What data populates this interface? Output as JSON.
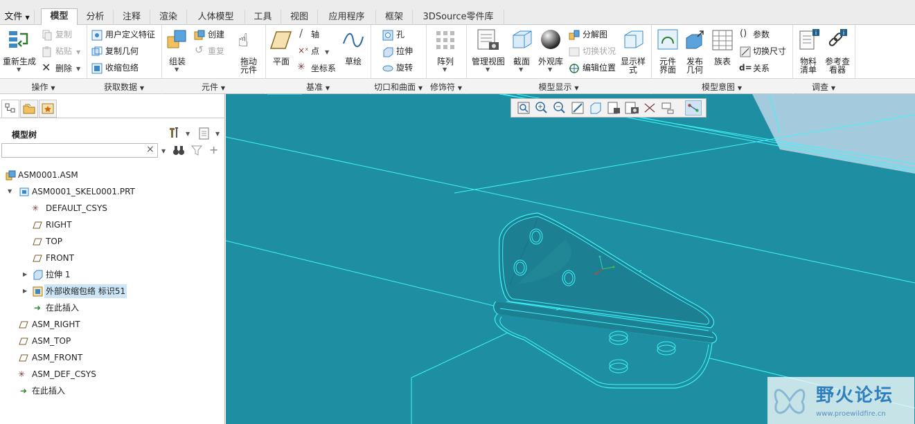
{
  "menu": {
    "file": "文件",
    "tabs": [
      {
        "label": "模型",
        "active": true
      },
      {
        "label": "分析"
      },
      {
        "label": "注释"
      },
      {
        "label": "渲染"
      },
      {
        "label": "人体模型"
      },
      {
        "label": "工具"
      },
      {
        "label": "视图"
      },
      {
        "label": "应用程序"
      },
      {
        "label": "框架"
      },
      {
        "label": "3DSource零件库"
      }
    ]
  },
  "ribbon": {
    "operations": {
      "regenerate": "重新生成",
      "copy": "复制",
      "paste": "粘贴",
      "delete": "删除",
      "group": "操作"
    },
    "get_data": {
      "udf": "用户定义特征",
      "copy_geom": "复制几何",
      "shrinkwrap": "收缩包络",
      "group": "获取数据"
    },
    "component": {
      "assemble": "组装",
      "create": "创建",
      "repeat": "重复",
      "drag_l1": "拖动",
      "drag_l2": "元件",
      "group": "元件"
    },
    "datum": {
      "plane": "平面",
      "axis": "轴",
      "point": "点",
      "csys": "坐标系",
      "sketch": "草绘",
      "group": "基准"
    },
    "cut_surface": {
      "hole": "孔",
      "extrude": "拉伸",
      "revolve": "旋转",
      "group": "切口和曲面"
    },
    "modifiers": {
      "pattern": "阵列",
      "group": "修饰符"
    },
    "model_display": {
      "manage_views": "管理视图",
      "section": "截面",
      "appearance": "外观库",
      "explode": "分解图",
      "toggle_status": "切换状况",
      "edit_position": "编辑位置",
      "display_l1": "显示样",
      "display_l2": "式",
      "group": "模型显示"
    },
    "model_intent": {
      "comp_l1": "元件",
      "comp_l2": "界面",
      "pub_l1": "发布",
      "pub_l2": "几何",
      "family": "族表",
      "params": "参数",
      "switch_dim": "切换尺寸",
      "relations": "关系",
      "group": "模型意图"
    },
    "investigate": {
      "bom_l1": "物料",
      "bom_l2": "清单",
      "ref_l1": "参考查",
      "ref_l2": "看器",
      "group": "调查"
    }
  },
  "model_tree": {
    "title": "模型树",
    "search_clear": "×",
    "items": [
      {
        "label": "ASM0001.ASM"
      },
      {
        "label": "ASM0001_SKEL0001.PRT"
      },
      {
        "label": "DEFAULT_CSYS"
      },
      {
        "label": "RIGHT"
      },
      {
        "label": "TOP"
      },
      {
        "label": "FRONT"
      },
      {
        "label": "拉伸 1"
      },
      {
        "label": "外部收缩包络 标识51"
      },
      {
        "label": "在此插入"
      },
      {
        "label": "ASM_RIGHT"
      },
      {
        "label": "ASM_TOP"
      },
      {
        "label": "ASM_FRONT"
      },
      {
        "label": "ASM_DEF_CSYS"
      },
      {
        "label": "在此插入"
      }
    ]
  },
  "viewport": {
    "background": "#1e8fa3",
    "edge_color": "#3ff3f8",
    "watermark": {
      "title": "野火论坛",
      "url": "www.proewildfire.cn"
    }
  }
}
